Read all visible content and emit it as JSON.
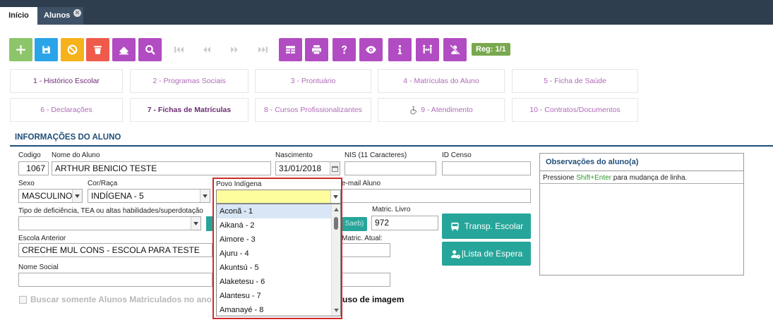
{
  "tabs": {
    "inicio": "Início",
    "alunos": "Alunos",
    "close": "✕"
  },
  "toolbar": {
    "register": "Reg: 1/1"
  },
  "sections": [
    "1 - Histórico Escolar",
    "2 - Programas Sociais",
    "3 - Prontuário",
    "4 - Matrículas do Aluno",
    "5 - Ficha de Saúde",
    "6 - Declarações",
    "7 - Fichas de Matrículas",
    "8 - Cursos Profissionalizantes",
    "9 - Atendimento",
    "10 - Contratos/Documentos"
  ],
  "form": {
    "title": "INFORMAÇÕES DO ALUNO",
    "codigo_label": "Codigo",
    "codigo": "1067",
    "nome_label": "Nome do Aluno",
    "nome": "ARTHUR BENICIO TESTE",
    "nascimento_label": "Nascimento",
    "nascimento": "31/01/2018",
    "nis_label": "NIS (11 Caracteres)",
    "idcenso_label": "ID Censo",
    "sexo_label": "Sexo",
    "sexo": "MASCULINO",
    "cor_label": "Cor/Raça",
    "cor": "INDÍGENA  - 5",
    "povo_label": "Povo Indígena",
    "email_label": "e-mail Aluno",
    "deficiencia_label": "Tipo de deficiência, TEA ou altas habilidades/superdotação",
    "saeb_partial": "Saeb)",
    "matric_livro_label": "Matric. Livro",
    "matric_livro": "972",
    "escola_label": "Escola Anterior",
    "escola": "CRECHE MUL CONS - ESCOLA PARA TESTE",
    "matric_atual_label": "Matric. Atual:",
    "nome_social_label": "Nome Social",
    "buscar_label": "Buscar somente Alunos Matriculados no ano A",
    "uso_imagem_partial": "uso de imagem"
  },
  "buttons": {
    "transp": "Transp. Escolar",
    "espera": "|Lista de Espera"
  },
  "obs": {
    "title": "Observações do aluno(a)",
    "hint_pre": "Pressione ",
    "hint_key": "Shift+Enter",
    "hint_post": " para mudança de linha."
  },
  "dropdown": {
    "items": [
      "Aconã - 1",
      "Aikaná - 2",
      "Aimore - 3",
      "Ajuru - 4",
      "Akuntsú - 5",
      "Alaketesu - 6",
      "Alantesu - 7",
      "Amanayé - 8"
    ]
  }
}
